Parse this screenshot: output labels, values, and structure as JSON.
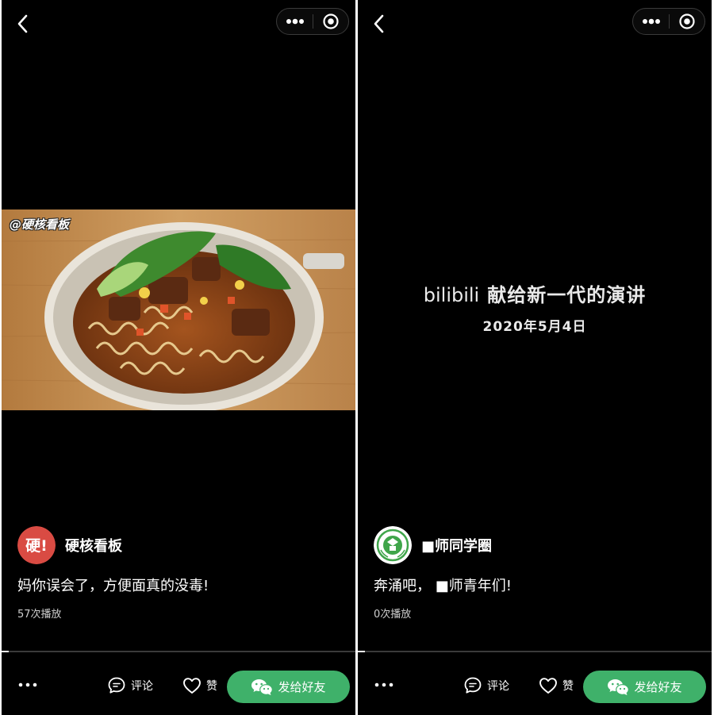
{
  "colors": {
    "background": "#000000",
    "accent_green": "#3fb16a",
    "text": "#ffffff",
    "muted": "#cfcfcf"
  },
  "panels": [
    {
      "nav": {
        "back_icon": "chevron-left-icon",
        "more_icon": "more-dots-icon",
        "close_icon": "target-icon"
      },
      "media": {
        "type": "image",
        "watermark": "@硬核看板"
      },
      "author": {
        "avatar_icon": "hard-core-logo",
        "avatar_text": "硬!",
        "name": "硬核看板"
      },
      "caption": "妈你误会了，方便面真的没毒!",
      "plays": "57次播放",
      "progress": 0.02,
      "actions": {
        "more_icon": "ellipsis-icon",
        "comment": "评论",
        "like": "赞",
        "share": "发给好友"
      }
    },
    {
      "nav": {
        "back_icon": "chevron-left-icon",
        "more_icon": "more-dots-icon",
        "close_icon": "target-icon"
      },
      "media": {
        "type": "title-card",
        "brand": "bilibili",
        "title": "献给新一代的演讲",
        "date": "2020年5月4日"
      },
      "author": {
        "avatar_icon": "school-emblem-logo",
        "name": "■师同学圈"
      },
      "caption": "奔涌吧，  ■师青年们!",
      "plays": "0次播放",
      "progress": 0.02,
      "actions": {
        "more_icon": "ellipsis-icon",
        "comment": "评论",
        "like": "赞",
        "share": "发给好友"
      }
    }
  ]
}
